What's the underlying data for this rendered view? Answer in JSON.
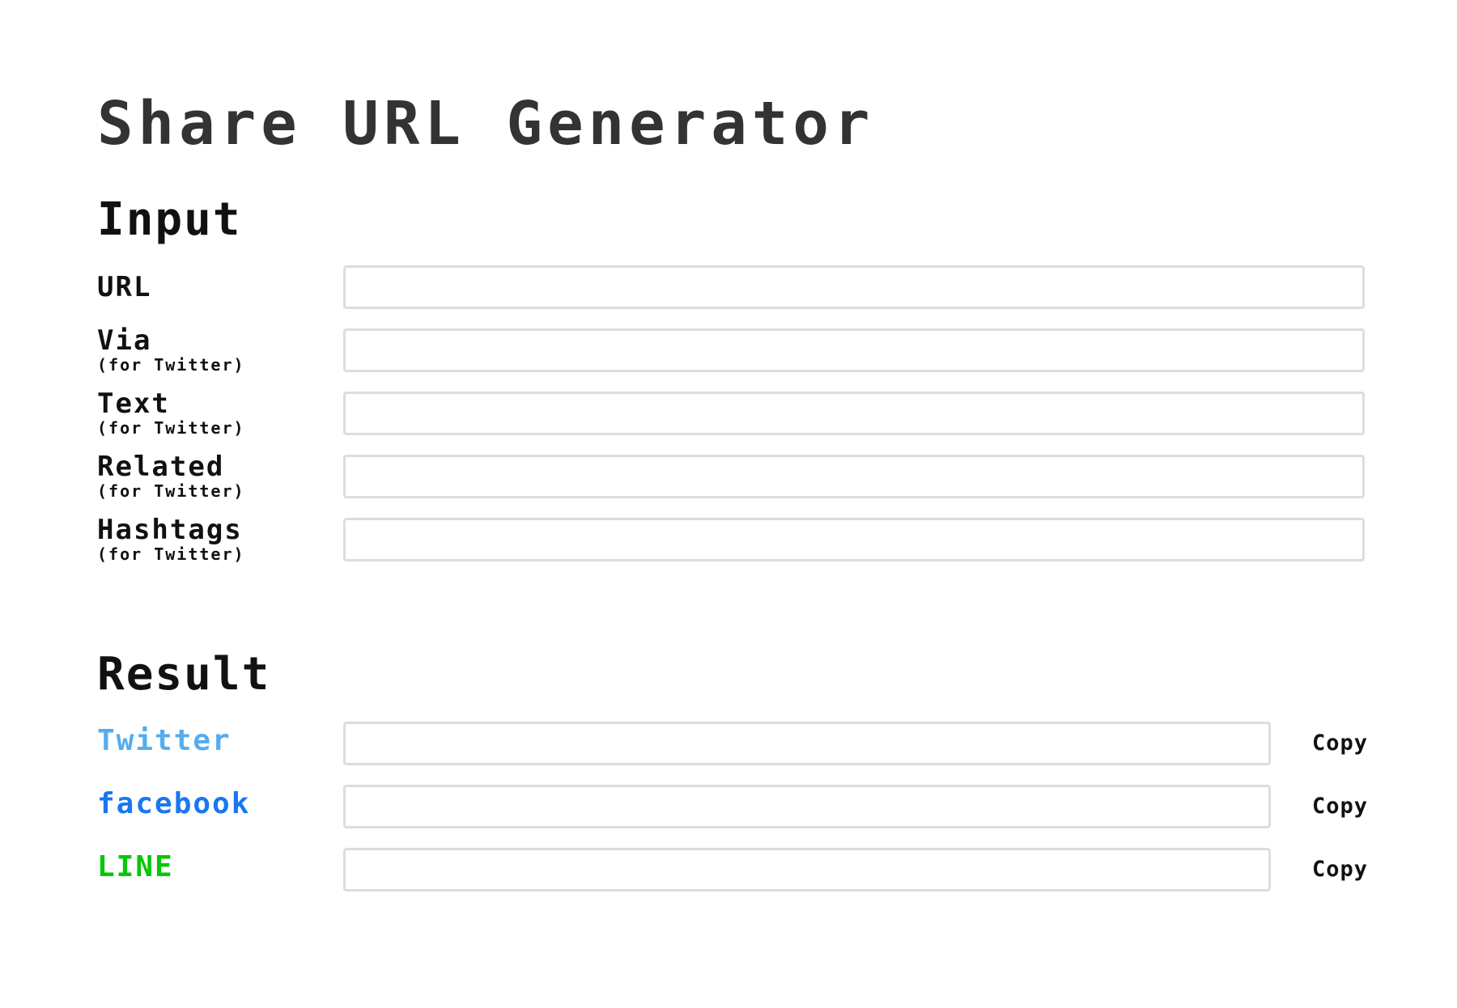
{
  "title": "Share URL Generator",
  "input_section": {
    "heading": "Input",
    "fields": [
      {
        "label": "URL",
        "sublabel": "",
        "value": "",
        "placeholder": ""
      },
      {
        "label": "Via",
        "sublabel": "(for Twitter)",
        "value": "",
        "placeholder": ""
      },
      {
        "label": "Text",
        "sublabel": "(for Twitter)",
        "value": "",
        "placeholder": ""
      },
      {
        "label": "Related",
        "sublabel": "(for Twitter)",
        "value": "",
        "placeholder": ""
      },
      {
        "label": "Hashtags",
        "sublabel": "(for Twitter)",
        "value": "",
        "placeholder": ""
      }
    ]
  },
  "result_section": {
    "heading": "Result",
    "rows": [
      {
        "label": "Twitter",
        "color": "#55acee",
        "value": "",
        "copy_label": "Copy"
      },
      {
        "label": "facebook",
        "color": "#1877f2",
        "value": "",
        "copy_label": "Copy"
      },
      {
        "label": "LINE",
        "color": "#06c706",
        "value": "",
        "copy_label": "Copy"
      }
    ]
  },
  "colors": {
    "title": "#333333",
    "text": "#111111",
    "field_border": "#dddddd",
    "background": "#ffffff"
  }
}
